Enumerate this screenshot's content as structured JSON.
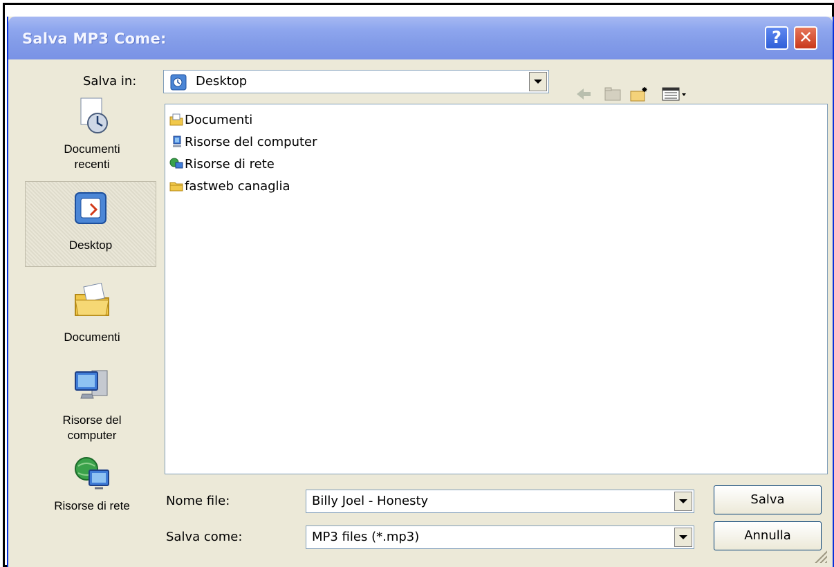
{
  "window": {
    "title": "Salva MP3 Come:",
    "help_label": "?",
    "close_label": "✕"
  },
  "save_in": {
    "label": "Salva in:",
    "value": "Desktop"
  },
  "toolbar": {
    "icons": [
      "back-arrow-icon",
      "up-folder-icon",
      "new-folder-icon",
      "view-menu-icon"
    ]
  },
  "places": [
    {
      "label": "Documenti recenti",
      "icon": "recent-documents-icon"
    },
    {
      "label": "Desktop",
      "icon": "desktop-icon",
      "selected": true
    },
    {
      "label": "Documenti",
      "icon": "my-documents-icon"
    },
    {
      "label": "Risorse del computer",
      "icon": "my-computer-icon"
    },
    {
      "label": "Risorse di rete",
      "icon": "network-places-icon"
    }
  ],
  "files": [
    {
      "name": "Documenti",
      "icon": "documents-folder-icon"
    },
    {
      "name": "Risorse del computer",
      "icon": "computer-icon"
    },
    {
      "name": "Risorse di rete",
      "icon": "network-icon"
    },
    {
      "name": "fastweb canaglia",
      "icon": "folder-icon"
    }
  ],
  "filename": {
    "label": "Nome file:",
    "value": "Billy Joel - Honesty"
  },
  "filetype": {
    "label": "Salva come:",
    "value": "MP3 files (*.mp3)"
  },
  "buttons": {
    "save": "Salva",
    "cancel": "Annulla"
  },
  "colors": {
    "titlebar": "#839ce8",
    "dialog_bg": "#ece9d8",
    "border": "#0831d9"
  }
}
